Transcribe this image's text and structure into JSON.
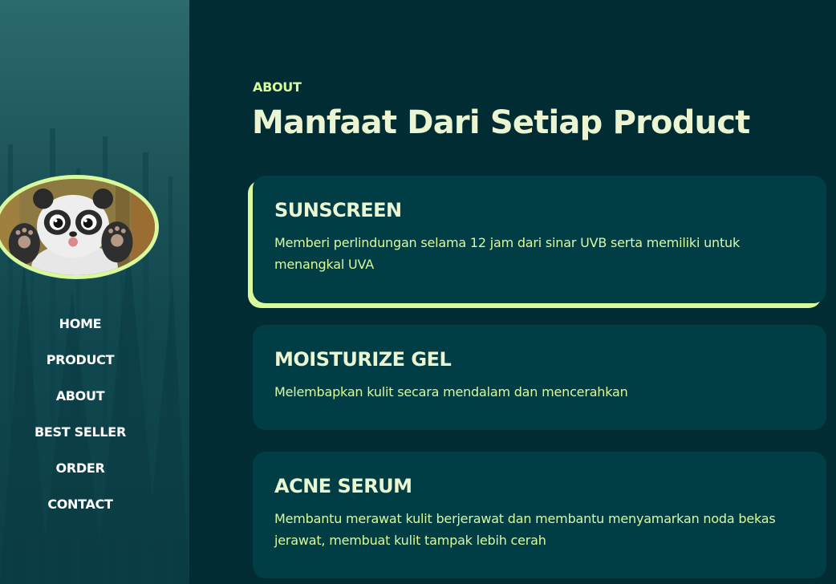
{
  "sidebar": {
    "avatar_alt": "panda",
    "nav": [
      {
        "label": "HOME"
      },
      {
        "label": "PRODUCT"
      },
      {
        "label": "ABOUT"
      },
      {
        "label": "BEST SELLER"
      },
      {
        "label": "ORDER"
      },
      {
        "label": "CONTACT"
      }
    ]
  },
  "main": {
    "eyebrow": "ABOUT",
    "title": "Manfaat Dari Setiap Product",
    "cards": [
      {
        "title": "SUNSCREEN",
        "desc": "Memberi perlindungan selama 12 jam dari sinar UVB serta memiliki untuk menangkal UVA",
        "active": true
      },
      {
        "title": "MOISTURIZE GEL",
        "desc": "Melembapkan kulit secara mendalam dan mencerahkan",
        "active": false
      },
      {
        "title": "ACNE SERUM",
        "desc": "Membantu merawat kulit berjerawat dan membantu menyamarkan noda bekas jerawat, membuat kulit tampak lebih cerah",
        "active": false
      }
    ]
  },
  "colors": {
    "accent": "#d9f99d",
    "heading": "#ecf5d2",
    "card_bg": "#003d45",
    "page_bg": "#022c34"
  }
}
